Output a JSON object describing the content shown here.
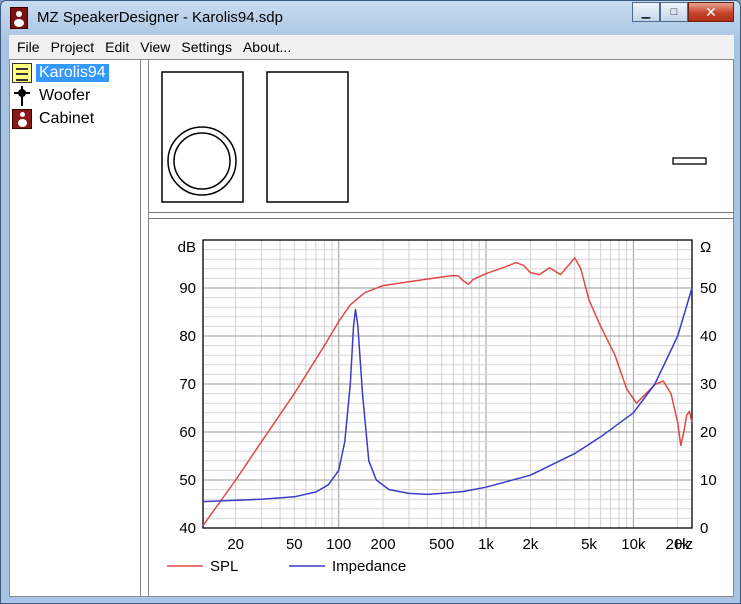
{
  "window": {
    "title": "MZ SpeakerDesigner - Karolis94.sdp",
    "app_icon": "speaker-icon",
    "buttons": {
      "minimize": "minimize-icon",
      "maximize": "maximize-icon",
      "close": "close-icon"
    }
  },
  "menu": [
    "File",
    "Project",
    "Edit",
    "View",
    "Settings",
    "About..."
  ],
  "tree": [
    {
      "label": "Karolis94",
      "icon": "project-icon",
      "selected": true
    },
    {
      "label": "Woofer",
      "icon": "woofer-icon",
      "selected": false
    },
    {
      "label": "Cabinet",
      "icon": "cabinet-icon",
      "selected": false
    }
  ],
  "colors": {
    "spl": "#e04848",
    "impedance": "#3b3bc8",
    "selection": "#3399ff"
  },
  "chart_data": {
    "type": "line",
    "xscale": "log",
    "xlim": [
      12,
      25000
    ],
    "grid": true,
    "xtick_labels": [
      "20",
      "50",
      "100",
      "200",
      "500",
      "1k",
      "2k",
      "5k",
      "10k",
      "20k"
    ],
    "xtick_values": [
      20,
      50,
      100,
      200,
      500,
      1000,
      2000,
      5000,
      10000,
      20000
    ],
    "xunit": "Hz",
    "left_axis": {
      "unit": "dB",
      "ylim": [
        40,
        100
      ],
      "tick_labels": [
        "40",
        "50",
        "60",
        "70",
        "80",
        "90"
      ],
      "tick_values": [
        40,
        50,
        60,
        70,
        80,
        90
      ]
    },
    "right_axis": {
      "unit": "Ω",
      "ylim": [
        0,
        60
      ],
      "tick_labels": [
        "0",
        "10",
        "20",
        "30",
        "40",
        "50"
      ],
      "tick_values": [
        0,
        10,
        20,
        30,
        40,
        50
      ]
    },
    "legend_placement": "bottom-left",
    "series": [
      {
        "name": "SPL",
        "axis": "left",
        "points": [
          [
            12,
            40.5
          ],
          [
            20,
            50
          ],
          [
            30,
            58
          ],
          [
            50,
            68
          ],
          [
            80,
            78
          ],
          [
            100,
            83
          ],
          [
            120,
            86.5
          ],
          [
            150,
            89
          ],
          [
            200,
            90.5
          ],
          [
            300,
            91.3
          ],
          [
            500,
            92.3
          ],
          [
            600,
            92.6
          ],
          [
            650,
            92.5
          ],
          [
            700,
            91.5
          ],
          [
            760,
            90.8
          ],
          [
            820,
            91.8
          ],
          [
            1000,
            93
          ],
          [
            1300,
            94.2
          ],
          [
            1600,
            95.3
          ],
          [
            1800,
            94.7
          ],
          [
            2000,
            93.2
          ],
          [
            2300,
            92.8
          ],
          [
            2700,
            94.2
          ],
          [
            3200,
            92.8
          ],
          [
            3700,
            95
          ],
          [
            4000,
            96.3
          ],
          [
            4400,
            94
          ],
          [
            5000,
            87.5
          ],
          [
            6000,
            82
          ],
          [
            7500,
            76
          ],
          [
            9000,
            69
          ],
          [
            10500,
            66
          ],
          [
            12000,
            67.8
          ],
          [
            14000,
            69.9
          ],
          [
            16000,
            70.6
          ],
          [
            18000,
            68
          ],
          [
            20000,
            62
          ],
          [
            21000,
            57.2
          ],
          [
            22000,
            60
          ],
          [
            23000,
            63.5
          ],
          [
            24000,
            64.3
          ],
          [
            25000,
            62
          ]
        ]
      },
      {
        "name": "Impedance",
        "axis": "right",
        "points": [
          [
            12,
            5.5
          ],
          [
            30,
            6
          ],
          [
            50,
            6.5
          ],
          [
            70,
            7.5
          ],
          [
            85,
            9
          ],
          [
            100,
            12
          ],
          [
            110,
            18
          ],
          [
            120,
            30
          ],
          [
            126,
            42
          ],
          [
            130,
            45.5
          ],
          [
            135,
            42
          ],
          [
            145,
            28
          ],
          [
            160,
            14
          ],
          [
            180,
            10
          ],
          [
            220,
            8
          ],
          [
            300,
            7.2
          ],
          [
            400,
            7
          ],
          [
            500,
            7.2
          ],
          [
            700,
            7.6
          ],
          [
            1000,
            8.5
          ],
          [
            2000,
            11
          ],
          [
            4000,
            15.5
          ],
          [
            6000,
            19
          ],
          [
            10000,
            24
          ],
          [
            14000,
            30
          ],
          [
            20000,
            40
          ],
          [
            25000,
            50
          ]
        ]
      }
    ]
  }
}
